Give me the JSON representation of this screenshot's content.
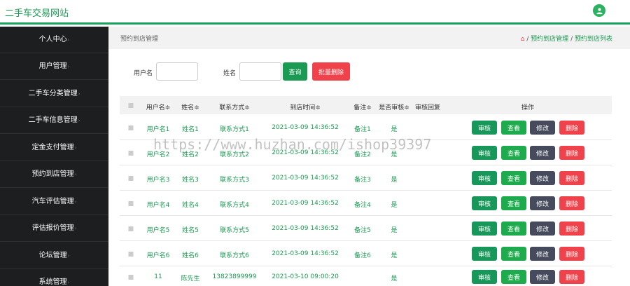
{
  "header": {
    "site_title": "二手车交易网站"
  },
  "sidebar": {
    "items": [
      {
        "label": "个人中心"
      },
      {
        "label": "用户管理"
      },
      {
        "label": "二手车分类管理"
      },
      {
        "label": "二手车信息管理"
      },
      {
        "label": "定金支付管理"
      },
      {
        "label": "预约到店管理"
      },
      {
        "label": "汽车评估管理"
      },
      {
        "label": "评估报价管理"
      },
      {
        "label": "论坛管理"
      },
      {
        "label": "系统管理"
      }
    ]
  },
  "breadcrumb": {
    "page_title": "预约到店管理",
    "sep": "/",
    "level1": "预约到店管理",
    "level2": "预约到店列表"
  },
  "search": {
    "username_label": "用户名",
    "name_label": "姓名",
    "query_button": "查询",
    "batch_delete_button": "批量删除"
  },
  "table": {
    "headers": [
      "用户名≑",
      "姓名≑",
      "联系方式≑",
      "到店时间≑",
      "备注≑",
      "是否审核≑",
      "审核回复",
      "操作"
    ],
    "action_labels": {
      "audit": "审核",
      "view": "查看",
      "edit": "修改",
      "remove": "删除"
    },
    "rows": [
      {
        "username": "用户名1",
        "name": "姓名1",
        "contact": "联系方式1",
        "time": "2021-03-09 14:36:52",
        "remark": "备注1",
        "audited": "是",
        "reply": ""
      },
      {
        "username": "用户名2",
        "name": "姓名2",
        "contact": "联系方式2",
        "time": "2021-03-09 14:36:52",
        "remark": "备注2",
        "audited": "是",
        "reply": ""
      },
      {
        "username": "用户名3",
        "name": "姓名3",
        "contact": "联系方式3",
        "time": "2021-03-09 14:36:52",
        "remark": "备注3",
        "audited": "是",
        "reply": ""
      },
      {
        "username": "用户名4",
        "name": "姓名4",
        "contact": "联系方式4",
        "time": "2021-03-09 14:36:52",
        "remark": "备注4",
        "audited": "是",
        "reply": ""
      },
      {
        "username": "用户名5",
        "name": "姓名5",
        "contact": "联系方式5",
        "time": "2021-03-09 14:36:52",
        "remark": "备注5",
        "audited": "是",
        "reply": ""
      },
      {
        "username": "用户名6",
        "name": "姓名6",
        "contact": "联系方式6",
        "time": "2021-03-09 14:36:52",
        "remark": "备注6",
        "audited": "是",
        "reply": ""
      },
      {
        "username": "11",
        "name": "陈先生",
        "contact": "13823899999",
        "time": "2021-03-10 09:00:20",
        "remark": "",
        "audited": "是",
        "reply": ""
      }
    ]
  },
  "watermark": "https://www.huzhan.com/ishop39397",
  "colors": {
    "brand_green": "#1a9a52",
    "danger_red": "#f0424a",
    "dark_gray": "#454a5c",
    "sidebar_bg": "#1d1e20"
  }
}
